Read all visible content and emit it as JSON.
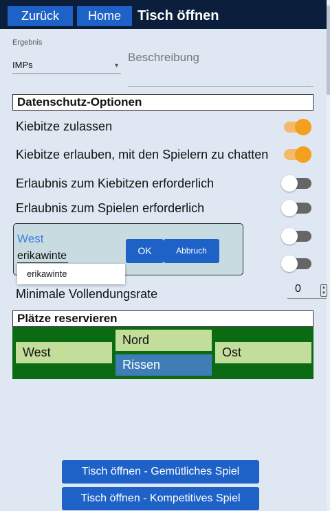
{
  "nav": {
    "back": "Zurück",
    "home": "Home",
    "title": "Tisch öffnen"
  },
  "form": {
    "result_label": "Ergebnis",
    "result_value": "IMPs",
    "description_placeholder": "Beschreibung"
  },
  "privacy": {
    "heading": "Datenschutz-Optionen",
    "options": [
      {
        "label": "Kiebitze zulassen",
        "enabled": true
      },
      {
        "label": "Kiebitze erlauben, mit den Spielern zu chatten",
        "enabled": true
      },
      {
        "label": "Erlaubnis zum Kiebitzen erforderlich",
        "enabled": false
      },
      {
        "label": "Erlaubnis zum Spielen erforderlich",
        "enabled": false
      },
      {
        "label": "",
        "enabled": false
      },
      {
        "label": "",
        "enabled": false
      }
    ],
    "min_completion_label": "Minimale Vollendungsrate",
    "min_completion_value": "0"
  },
  "dialog": {
    "seat": "West",
    "input_value": "erikawinte",
    "ok": "OK",
    "cancel": "Abbruch",
    "suggestion": "erikawinte"
  },
  "reserve": {
    "heading": "Plätze reservieren",
    "west": "West",
    "north": "Nord",
    "east": "Ost",
    "south": "Rissen"
  },
  "actions": {
    "casual": "Tisch öffnen - Gemütliches Spiel",
    "competitive": "Tisch öffnen - Kompetitives Spiel"
  },
  "colors": {
    "accent": "#1e62c8",
    "topbar": "#0b1e3b",
    "toggle_on": "#f2a01e",
    "seat_area": "#0a6b12"
  }
}
